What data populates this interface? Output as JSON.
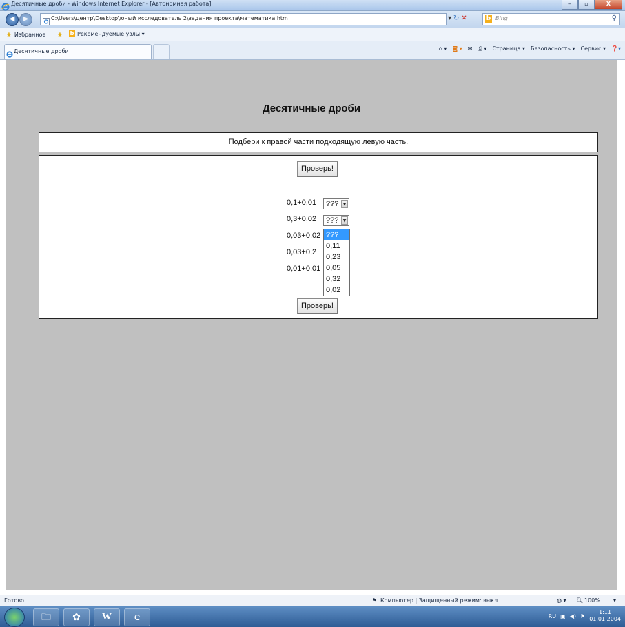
{
  "window": {
    "title": "Десятичные дроби - Windows Internet Explorer - [Автономная работа]",
    "buttons": {
      "minimize": "–",
      "maximize": "▫",
      "close": "X"
    }
  },
  "address": {
    "url": "C:\\Users\\центр\\Desktop\\юный исследователь 2\\задания проекта\\математика.htm",
    "search_placeholder": "Bing"
  },
  "favorites": {
    "label": "Избранное",
    "suggested": "Рекомендуемые узлы ▾"
  },
  "tab": {
    "label": "Десятичные дроби"
  },
  "command_bar": {
    "page": "Страница ▾",
    "safety": "Безопасность ▾",
    "tools": "Сервис ▾"
  },
  "page": {
    "title": "Десятичные дроби",
    "instruction": "Подбери к правой части подходящую левую часть.",
    "check_button": "Проверь!",
    "rows": [
      {
        "expression": "0,1+0,01",
        "selected": "???"
      },
      {
        "expression": "0,3+0,02",
        "selected": "???"
      },
      {
        "expression": "0,03+0,02",
        "selected": ""
      },
      {
        "expression": "0,03+0,2",
        "selected": ""
      },
      {
        "expression": "0,01+0,01",
        "selected": ""
      }
    ],
    "dropdown_options": [
      "???",
      "0,11",
      "0,23",
      "0,05",
      "0,32",
      "0,02"
    ],
    "highlighted_option": "???"
  },
  "status": {
    "left": "Готово",
    "zone": "Компьютер | Защищенный режим: выкл.",
    "zoom": "100%"
  },
  "taskbar": {
    "lang": "RU",
    "time": "1:11",
    "date": "01.01.2004"
  },
  "colors": {
    "content_bg": "#c0c0c0",
    "highlight": "#3399ff",
    "titlebar": "#a9c6ea"
  }
}
